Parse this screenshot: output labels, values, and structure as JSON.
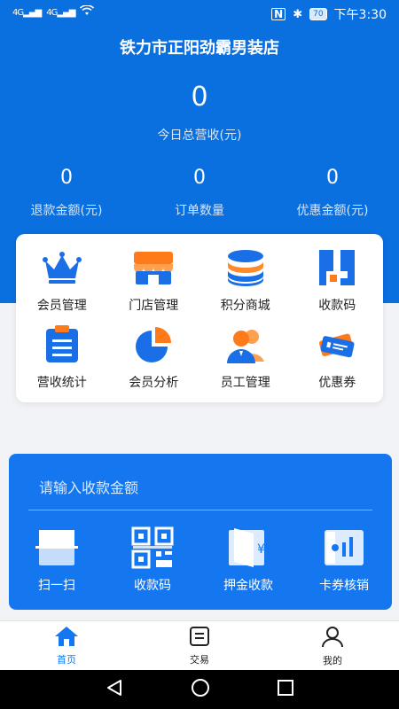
{
  "status_bar": {
    "signal_1": "4G",
    "signal_2": "4G",
    "battery": "70",
    "time": "下午3:30"
  },
  "header": {
    "store_name": "铁力市正阳劲霸男装店",
    "total_value": "0",
    "total_label": "今日总营收(元)",
    "stats": [
      {
        "value": "0",
        "label": "退款金额(元)"
      },
      {
        "value": "0",
        "label": "订单数量"
      },
      {
        "value": "0",
        "label": "优惠金额(元)"
      }
    ]
  },
  "menu": [
    {
      "label": "会员管理",
      "icon": "crown-icon"
    },
    {
      "label": "门店管理",
      "icon": "store-icon"
    },
    {
      "label": "积分商城",
      "icon": "coins-icon"
    },
    {
      "label": "收款码",
      "icon": "payment-code-icon"
    },
    {
      "label": "营收统计",
      "icon": "clipboard-icon"
    },
    {
      "label": "会员分析",
      "icon": "pie-chart-icon"
    },
    {
      "label": "员工管理",
      "icon": "users-icon"
    },
    {
      "label": "优惠券",
      "icon": "coupon-icon"
    }
  ],
  "payment": {
    "placeholder": "请输入收款金额",
    "actions": [
      {
        "label": "扫一扫",
        "icon": "scan-icon"
      },
      {
        "label": "收款码",
        "icon": "qr-code-icon"
      },
      {
        "label": "押金收款",
        "icon": "deposit-icon"
      },
      {
        "label": "卡券核销",
        "icon": "ticket-icon"
      }
    ]
  },
  "tabbar": [
    {
      "label": "首页",
      "icon": "home-icon"
    },
    {
      "label": "交易",
      "icon": "transaction-icon"
    },
    {
      "label": "我的",
      "icon": "profile-icon"
    }
  ],
  "colors": {
    "primary": "#0a6fdf",
    "card_blue": "#1577f0",
    "accent_orange": "#ff7a1a"
  }
}
